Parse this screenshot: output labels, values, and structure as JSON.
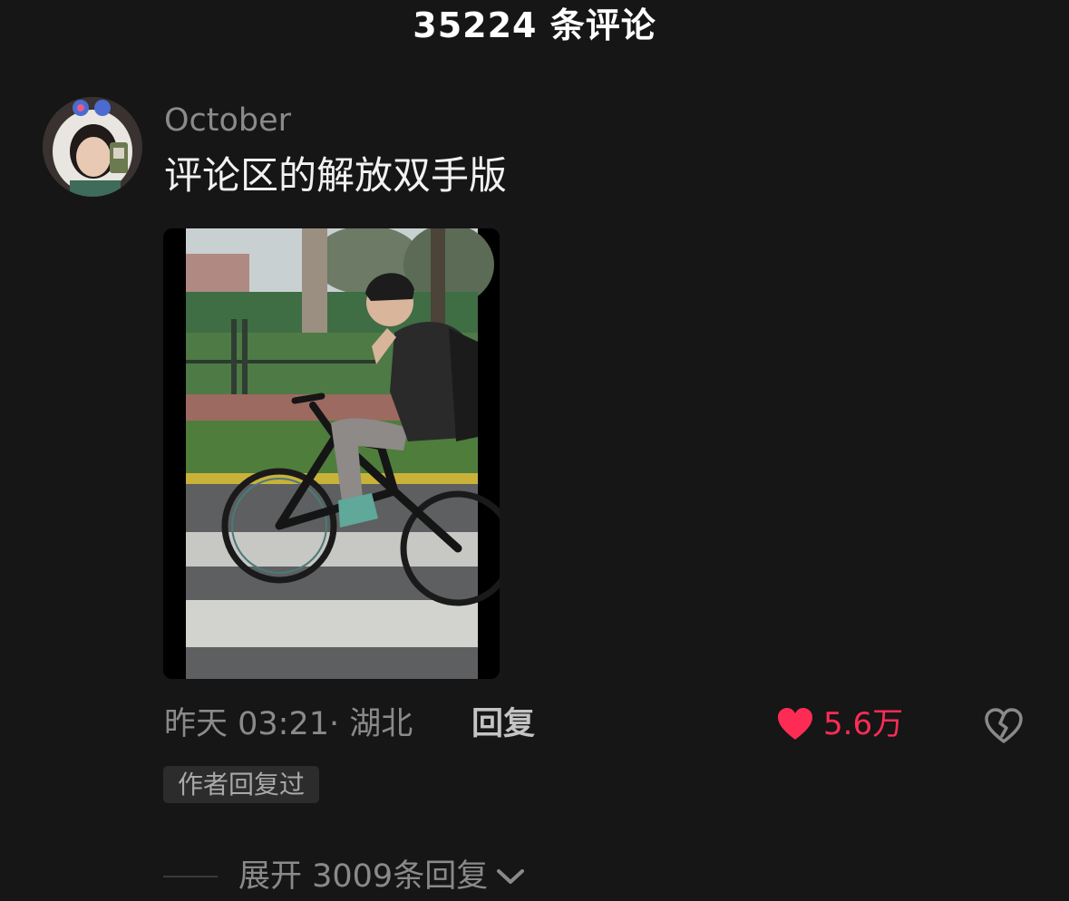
{
  "header": {
    "title": "35224 条评论"
  },
  "comment": {
    "username": "October",
    "text": "评论区的解放双手版",
    "meta": "昨天 03:21· 湖北",
    "reply_label": "回复",
    "likes": "5.6万",
    "author_badge": "作者回复过",
    "expand_label": "展开 3009条回复"
  },
  "icons": {
    "like": "heart-icon",
    "dislike": "broken-heart-icon",
    "expand": "chevron-down-icon"
  },
  "colors": {
    "background": "#161616",
    "like_accent": "#fe2c55",
    "secondary_text": "#8a8a8a"
  }
}
